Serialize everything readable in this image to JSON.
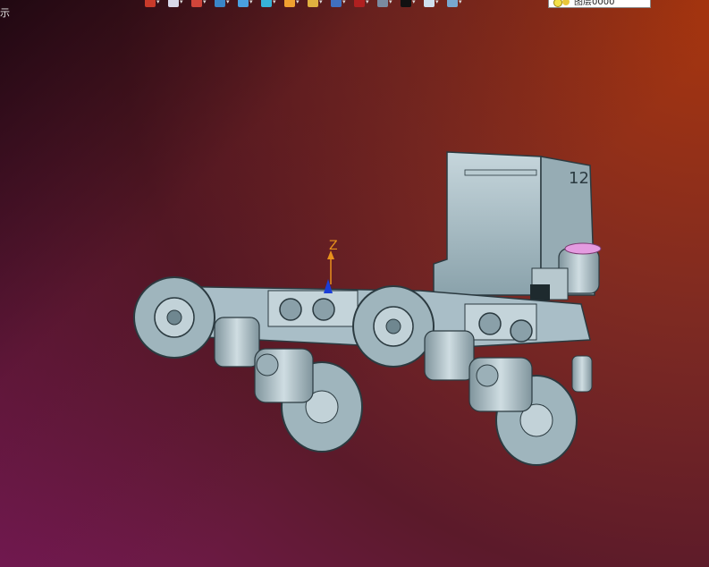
{
  "window": {
    "corner_label": "示",
    "layer_combo_value": "图层0000"
  },
  "toolbar": {
    "buttons": [
      {
        "name": "new-file-icon",
        "color": "#c83a2a"
      },
      {
        "name": "open-file-icon",
        "color": "#d8d8e8"
      },
      {
        "name": "pencil-icon",
        "color": "#d0453a"
      },
      {
        "name": "box-icon",
        "color": "#3a86c8"
      },
      {
        "name": "cube-blue-icon",
        "color": "#4aa0e0"
      },
      {
        "name": "cube-cyan-icon",
        "color": "#37b3d8"
      },
      {
        "name": "pie-render-icon",
        "color": "#f0a030"
      },
      {
        "name": "image-search-icon",
        "color": "#e0b040"
      },
      {
        "name": "refresh-icon",
        "color": "#4070c0"
      },
      {
        "name": "color-fill-icon",
        "color": "#b02020"
      },
      {
        "name": "monitor-icon",
        "color": "#7a8aa0"
      },
      {
        "name": "black-square-icon",
        "color": "#111111"
      },
      {
        "name": "document-icon",
        "color": "#cfe0ee"
      },
      {
        "name": "stack-icon",
        "color": "#78a8d0"
      }
    ]
  },
  "viewport": {
    "axis_label": "Z",
    "model_color": "#a9c0c9",
    "accent_color": "#e49be0"
  }
}
